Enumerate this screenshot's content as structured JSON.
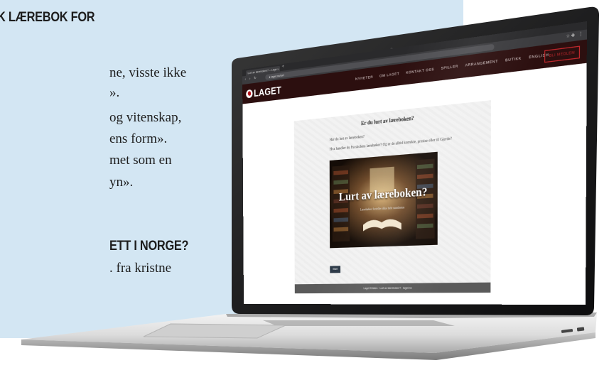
{
  "article": {
    "heading1": "K LÆREBOK FOR",
    "lines": [
      "ne, visste ikke",
      "».",
      "og vitenskap,",
      "ens form».",
      "met som en",
      "yn»."
    ],
    "heading2": "ETT I NORGE?",
    "line_last": ". fra kristne"
  },
  "browser": {
    "tab_title": "Lurt av læreboken? – Lage…",
    "tab_close": "×",
    "new_tab": "+",
    "nav_glyphs": "‹ › ↻",
    "url": "● laget.no/lurt",
    "ext_icons": "☆ ✤",
    "menu_glyph": "⋮"
  },
  "site": {
    "logo_text": "LAGET",
    "nav": [
      "NYHETER",
      "OM LAGET",
      "KONTAKT OSS",
      "SPILLER",
      "ARRANGEMENT",
      "BUTIKK",
      "ENGLISH"
    ],
    "cta": "BLI MEDLEM"
  },
  "card": {
    "title": "Er du lurt av læreboken?",
    "question": "Har du lurt av læreboken?",
    "intro": "Hva handler du fra skolens lærebøker? Og er de alltid korrekte, presise eller til Gjerde?",
    "image_text": "Lurt av læreboken?",
    "image_sub": "Lærebøker forteller ikke hele sannheten",
    "button": "Start",
    "footer": "Laget Kristen · Lurt av læreboken? · laget.no"
  },
  "colors": {
    "panel": "#d3e6f3",
    "site_header": "#2c0f0f",
    "logo_red": "#b5121b",
    "cta_red": "#c0282d"
  }
}
